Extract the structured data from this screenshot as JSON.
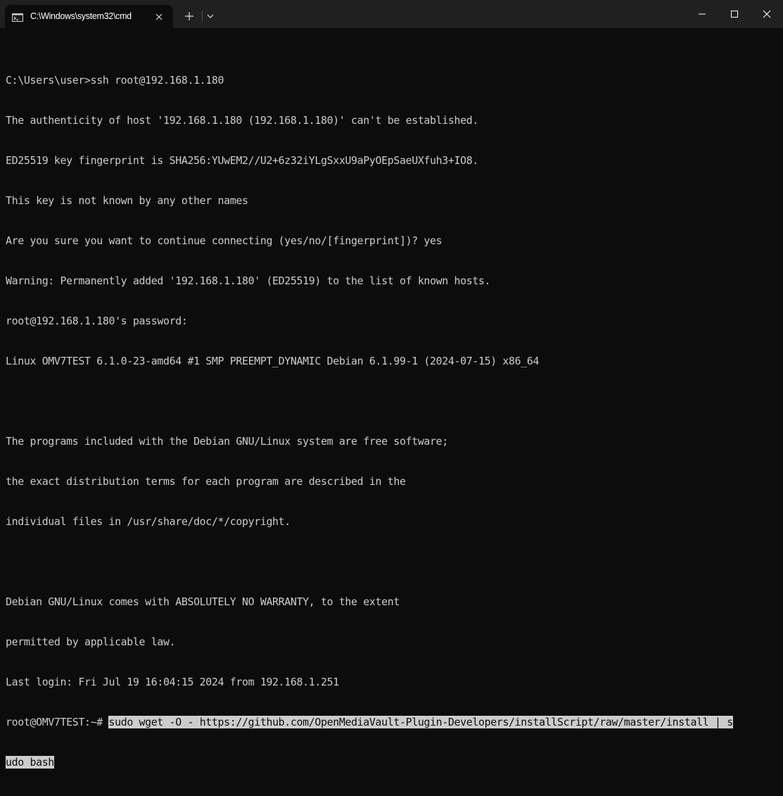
{
  "window": {
    "tab_title": "C:\\Windows\\system32\\cmd",
    "tab_icon": "cmd-icon",
    "close_tab_icon": "close-icon",
    "new_tab_icon": "plus-icon",
    "dropdown_icon": "chevron-down-icon",
    "minimize_icon": "minimize-icon",
    "maximize_icon": "maximize-icon",
    "close_icon": "close-icon"
  },
  "terminal": {
    "lines": [
      "C:\\Users\\user>ssh root@192.168.1.180",
      "The authenticity of host '192.168.1.180 (192.168.1.180)' can't be established.",
      "ED25519 key fingerprint is SHA256:YUwEM2//U2+6z32iYLgSxxU9aPyOEpSaeUXfuh3+IO8.",
      "This key is not known by any other names",
      "Are you sure you want to continue connecting (yes/no/[fingerprint])? yes",
      "Warning: Permanently added '192.168.1.180' (ED25519) to the list of known hosts.",
      "root@192.168.1.180's password:",
      "Linux OMV7TEST 6.1.0-23-amd64 #1 SMP PREEMPT_DYNAMIC Debian 6.1.99-1 (2024-07-15) x86_64",
      "",
      "The programs included with the Debian GNU/Linux system are free software;",
      "the exact distribution terms for each program are described in the",
      "individual files in /usr/share/doc/*/copyright.",
      "",
      "Debian GNU/Linux comes with ABSOLUTELY NO WARRANTY, to the extent",
      "permitted by applicable law.",
      "Last login: Fri Jul 19 16:04:15 2024 from 192.168.1.251"
    ],
    "prompt": "root@OMV7TEST:~# ",
    "command_part1": "sudo wget -O - https://github.com/OpenMediaVault-Plugin-Developers/installScript/raw/master/install | s",
    "command_part2": "udo bash"
  },
  "colors": {
    "background": "#0c0c0c",
    "titlebar": "#202020",
    "text": "#cccccc",
    "selection": "#cccccc"
  }
}
